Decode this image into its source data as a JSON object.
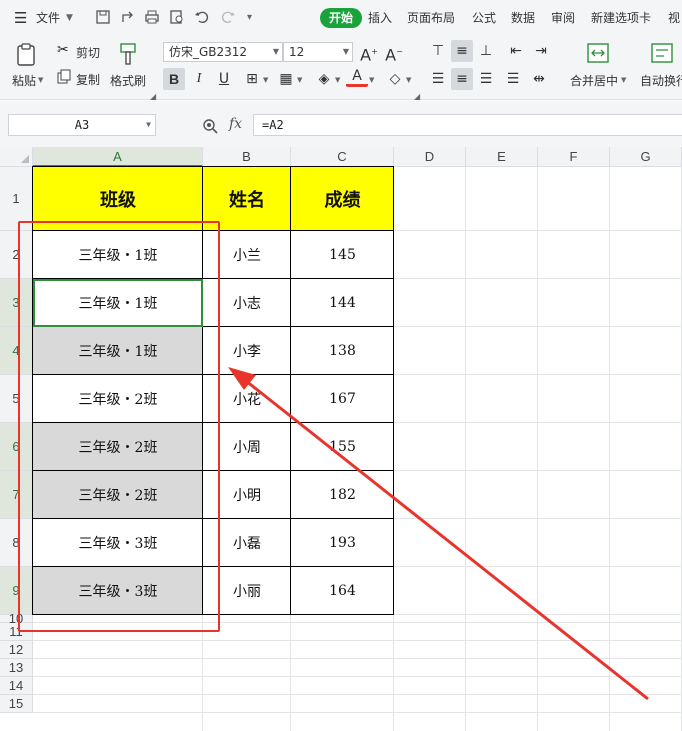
{
  "menu": {
    "file_label": "文件",
    "tabs": [
      "开始",
      "插入",
      "页面布局",
      "公式",
      "数据",
      "审阅",
      "新建选项卡",
      "视"
    ],
    "active_tab": "开始"
  },
  "ribbon": {
    "paste_label": "粘贴",
    "cut_label": "剪切",
    "copy_label": "复制",
    "format_painter_label": "格式刷",
    "font_name": "仿宋_GB2312",
    "font_size": "12",
    "bold": "B",
    "italic": "I",
    "underline": "U",
    "merge_center_label": "合并居中",
    "wrap_label": "自动换行"
  },
  "formula_bar": {
    "cell_ref": "A3",
    "fx_label": "fx",
    "formula": "=A2"
  },
  "sheet": {
    "columns": [
      "A",
      "B",
      "C",
      "D",
      "E",
      "F",
      "G"
    ],
    "selected_column": "A",
    "rows": [
      "1",
      "2",
      "3",
      "4",
      "5",
      "6",
      "7",
      "8",
      "9",
      "10",
      "11",
      "12",
      "13",
      "14",
      "15"
    ],
    "header_cells": [
      "班级",
      "姓名",
      "成绩"
    ],
    "records": [
      {
        "class": "三年级・1班",
        "name": "小兰",
        "score": "145"
      },
      {
        "class": "三年级・1班",
        "name": "小志",
        "score": "144"
      },
      {
        "class": "三年级・1班",
        "name": "小李",
        "score": "138"
      },
      {
        "class": "三年级・2班",
        "name": "小花",
        "score": "167"
      },
      {
        "class": "三年级・2班",
        "name": "小周",
        "score": "155"
      },
      {
        "class": "三年级・2班",
        "name": "小明",
        "score": "182"
      },
      {
        "class": "三年级・3班",
        "name": "小磊",
        "score": "193"
      },
      {
        "class": "三年级・3班",
        "name": "小丽",
        "score": "164"
      }
    ]
  },
  "colors": {
    "accent": "#1aa33b",
    "header_fill": "#ffff00",
    "grey_fill": "#d9d9d9",
    "annotation": "#e8342b"
  }
}
